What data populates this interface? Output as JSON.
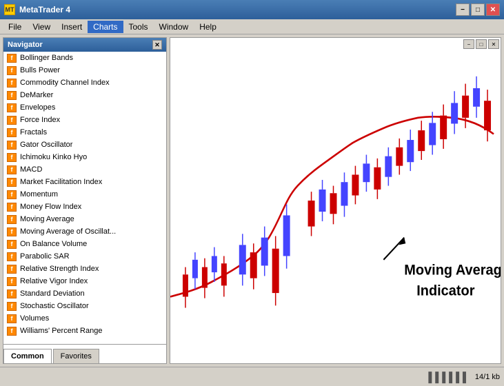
{
  "titleBar": {
    "title": "MetaTrader 4",
    "iconText": "MT",
    "minimize": "−",
    "maximize": "□",
    "close": "✕"
  },
  "menuBar": {
    "items": [
      "File",
      "View",
      "Insert",
      "Charts",
      "Tools",
      "Window",
      "Help"
    ]
  },
  "navigator": {
    "title": "Navigator",
    "close": "✕",
    "items": [
      "Bollinger Bands",
      "Bulls Power",
      "Commodity Channel Index",
      "DeMarker",
      "Envelopes",
      "Force Index",
      "Fractals",
      "Gator Oscillator",
      "Ichimoku Kinko Hyo",
      "MACD",
      "Market Facilitation Index",
      "Momentum",
      "Money Flow Index",
      "Moving Average",
      "Moving Average of Oscillat...",
      "On Balance Volume",
      "Parabolic SAR",
      "Relative Strength Index",
      "Relative Vigor Index",
      "Standard Deviation",
      "Stochastic Oscillator",
      "Volumes",
      "Williams' Percent Range"
    ],
    "tabs": [
      {
        "label": "Common",
        "active": true
      },
      {
        "label": "Favorites",
        "active": false
      }
    ]
  },
  "chart": {
    "annotation": "Moving Average\nIndicator"
  },
  "statusBar": {
    "barsIcon": "▌▌▌▌▌▌",
    "info": "14/1 kb"
  },
  "innerControls": {
    "minimize": "−",
    "maximize": "□",
    "close": "✕"
  }
}
